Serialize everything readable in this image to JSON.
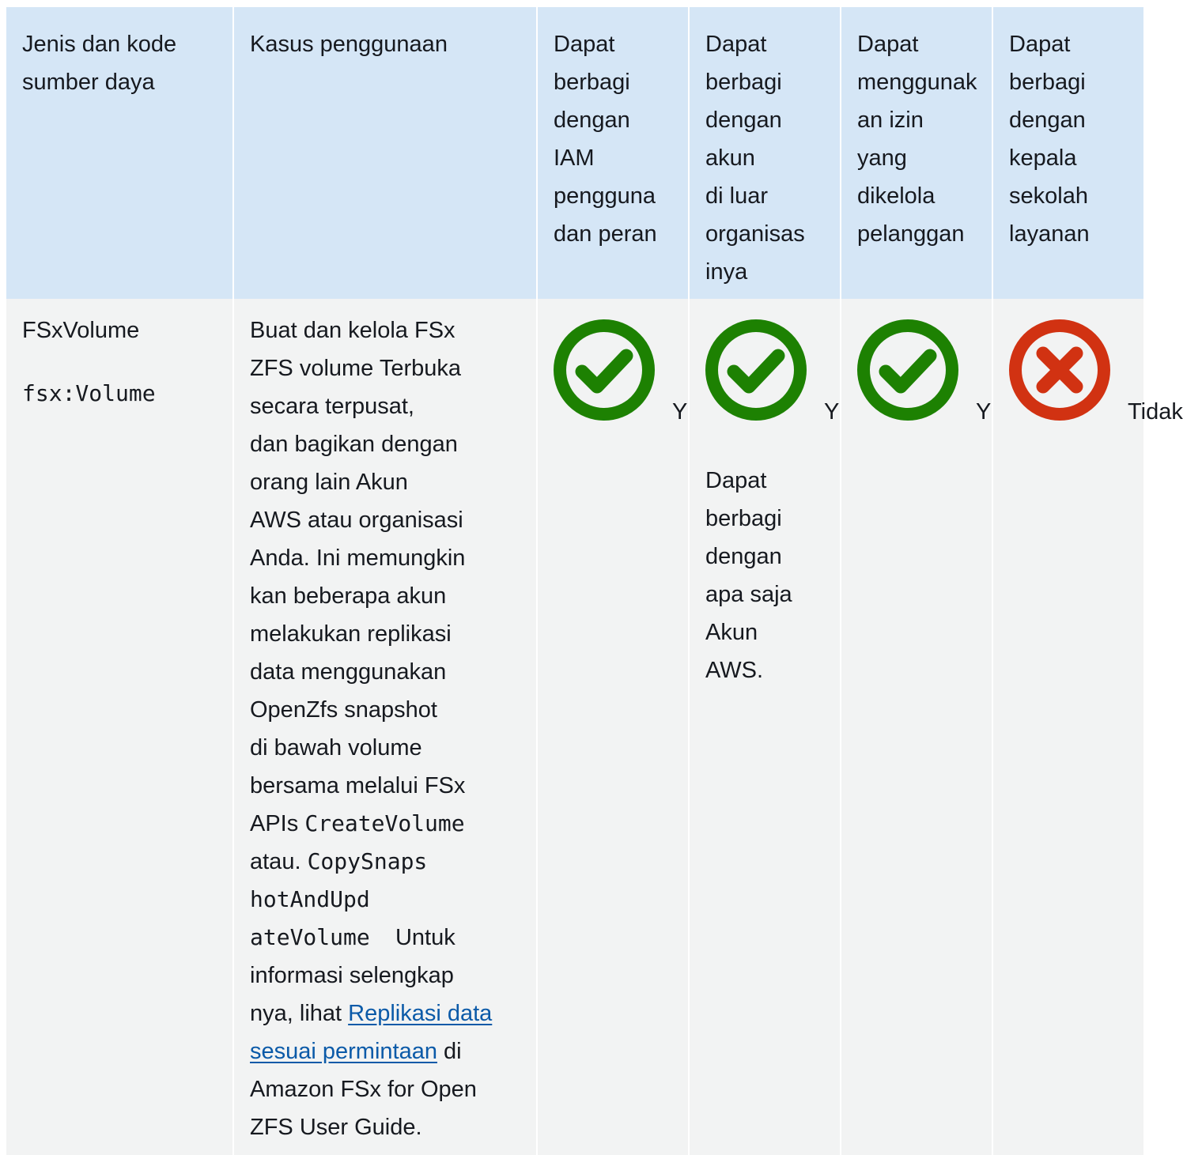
{
  "table": {
    "headers": [
      [
        "Jenis dan kode",
        "sumber daya"
      ],
      [
        "Kasus penggunaan"
      ],
      [
        "Dapat",
        "berbagi",
        "dengan",
        "IAM",
        "pengguna",
        "dan peran"
      ],
      [
        "Dapat",
        "berbagi",
        "dengan",
        "akun",
        "di luar",
        "organisas",
        "inya"
      ],
      [
        "Dapat",
        "menggunak",
        "an izin",
        "yang",
        "dikelola",
        "pelanggan"
      ],
      [
        "Dapat",
        "berbagi",
        "dengan",
        "kepala",
        "sekolah",
        "layanan"
      ]
    ],
    "row": {
      "resource_name": "FSxVolume",
      "resource_code": "fsx:Volume",
      "use_case": {
        "lines_1": [
          "Buat dan kelola FSx",
          "ZFS volume Terbuka",
          "secara terpusat,",
          "dan bagikan dengan",
          "orang lain Akun",
          "AWS atau organisasi",
          "Anda. Ini memungkin",
          "kan beberapa akun",
          "melakukan replikasi",
          "data menggunakan",
          "OpenZfs snapshot",
          "di bawah volume",
          "bersama melalui FSx"
        ],
        "apis_prefix": "APIs ",
        "api_1": "CreateVolume",
        "atau": "atau. ",
        "api_2_part1": "CopySnaps",
        "api_2_part2": "hotAndUpd",
        "api_2_part3": "ateVolume",
        "untuk": "Untuk",
        "info_line": "informasi selengkap",
        "nya_lihat": "nya, lihat ",
        "link_part1": "Replikasi data",
        "link_part2": "sesuai permintaan",
        "di": " di",
        "tail_1": "Amazon FSx for Open",
        "tail_2": "ZFS User Guide."
      },
      "iam_share": {
        "status": "yes",
        "label": "Y"
      },
      "outside_org_share": {
        "status": "yes",
        "label": "Y",
        "note": [
          "Dapat",
          "berbagi",
          "dengan",
          "apa saja",
          "Akun",
          "AWS."
        ]
      },
      "customer_managed_permissions": {
        "status": "yes",
        "label": "Y"
      },
      "service_principals": {
        "status": "no",
        "label": "Tidak"
      }
    }
  },
  "colors": {
    "header_bg": "#d5e6f6",
    "body_bg": "#f2f3f3",
    "yes": "#1d8102",
    "no": "#d13212",
    "link": "#0b5aa8"
  }
}
